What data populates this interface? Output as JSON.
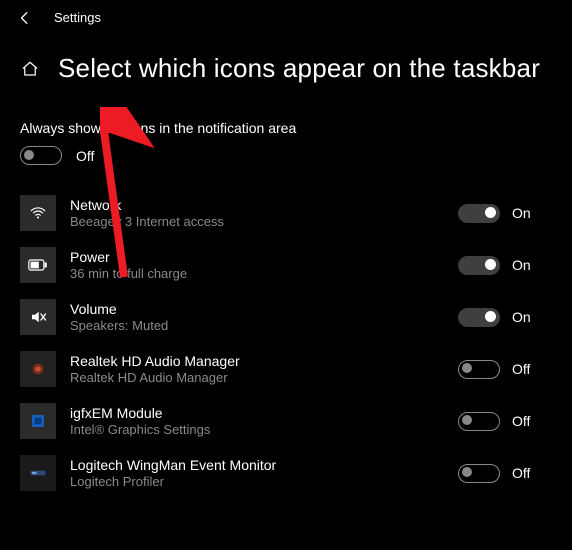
{
  "header": {
    "label": "Settings"
  },
  "page": {
    "title": "Select which icons appear on the taskbar"
  },
  "master": {
    "label": "Always show all icons in the notification area",
    "state_label": "Off",
    "on": false
  },
  "icons": [
    {
      "name": "Network",
      "sub": "Beeagey 3 Internet access",
      "state_label": "On",
      "on": true,
      "icon": "wifi",
      "box": "normal"
    },
    {
      "name": "Power",
      "sub": "36 min to full charge",
      "state_label": "On",
      "on": true,
      "icon": "battery",
      "box": "normal"
    },
    {
      "name": "Volume",
      "sub": "Speakers: Muted",
      "state_label": "On",
      "on": true,
      "icon": "volume-mute",
      "box": "normal"
    },
    {
      "name": "Realtek HD Audio Manager",
      "sub": "Realtek HD Audio Manager",
      "state_label": "Off",
      "on": false,
      "icon": "realtek",
      "box": "darker"
    },
    {
      "name": "igfxEM Module",
      "sub": "Intel® Graphics Settings",
      "state_label": "Off",
      "on": false,
      "icon": "intel",
      "box": "normal"
    },
    {
      "name": "Logitech WingMan Event Monitor",
      "sub": "Logitech Profiler",
      "state_label": "Off",
      "on": false,
      "icon": "logitech",
      "box": "blank"
    }
  ]
}
